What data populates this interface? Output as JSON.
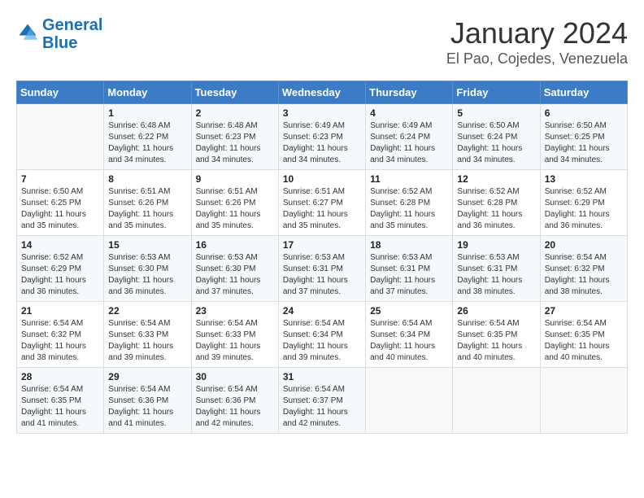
{
  "header": {
    "logo_line1": "General",
    "logo_line2": "Blue",
    "title": "January 2024",
    "subtitle": "El Pao, Cojedes, Venezuela"
  },
  "weekdays": [
    "Sunday",
    "Monday",
    "Tuesday",
    "Wednesday",
    "Thursday",
    "Friday",
    "Saturday"
  ],
  "weeks": [
    [
      {
        "day": "",
        "info": ""
      },
      {
        "day": "1",
        "info": "Sunrise: 6:48 AM\nSunset: 6:22 PM\nDaylight: 11 hours\nand 34 minutes."
      },
      {
        "day": "2",
        "info": "Sunrise: 6:48 AM\nSunset: 6:23 PM\nDaylight: 11 hours\nand 34 minutes."
      },
      {
        "day": "3",
        "info": "Sunrise: 6:49 AM\nSunset: 6:23 PM\nDaylight: 11 hours\nand 34 minutes."
      },
      {
        "day": "4",
        "info": "Sunrise: 6:49 AM\nSunset: 6:24 PM\nDaylight: 11 hours\nand 34 minutes."
      },
      {
        "day": "5",
        "info": "Sunrise: 6:50 AM\nSunset: 6:24 PM\nDaylight: 11 hours\nand 34 minutes."
      },
      {
        "day": "6",
        "info": "Sunrise: 6:50 AM\nSunset: 6:25 PM\nDaylight: 11 hours\nand 34 minutes."
      }
    ],
    [
      {
        "day": "7",
        "info": "Sunrise: 6:50 AM\nSunset: 6:25 PM\nDaylight: 11 hours\nand 35 minutes."
      },
      {
        "day": "8",
        "info": "Sunrise: 6:51 AM\nSunset: 6:26 PM\nDaylight: 11 hours\nand 35 minutes."
      },
      {
        "day": "9",
        "info": "Sunrise: 6:51 AM\nSunset: 6:26 PM\nDaylight: 11 hours\nand 35 minutes."
      },
      {
        "day": "10",
        "info": "Sunrise: 6:51 AM\nSunset: 6:27 PM\nDaylight: 11 hours\nand 35 minutes."
      },
      {
        "day": "11",
        "info": "Sunrise: 6:52 AM\nSunset: 6:28 PM\nDaylight: 11 hours\nand 35 minutes."
      },
      {
        "day": "12",
        "info": "Sunrise: 6:52 AM\nSunset: 6:28 PM\nDaylight: 11 hours\nand 36 minutes."
      },
      {
        "day": "13",
        "info": "Sunrise: 6:52 AM\nSunset: 6:29 PM\nDaylight: 11 hours\nand 36 minutes."
      }
    ],
    [
      {
        "day": "14",
        "info": "Sunrise: 6:52 AM\nSunset: 6:29 PM\nDaylight: 11 hours\nand 36 minutes."
      },
      {
        "day": "15",
        "info": "Sunrise: 6:53 AM\nSunset: 6:30 PM\nDaylight: 11 hours\nand 36 minutes."
      },
      {
        "day": "16",
        "info": "Sunrise: 6:53 AM\nSunset: 6:30 PM\nDaylight: 11 hours\nand 37 minutes."
      },
      {
        "day": "17",
        "info": "Sunrise: 6:53 AM\nSunset: 6:31 PM\nDaylight: 11 hours\nand 37 minutes."
      },
      {
        "day": "18",
        "info": "Sunrise: 6:53 AM\nSunset: 6:31 PM\nDaylight: 11 hours\nand 37 minutes."
      },
      {
        "day": "19",
        "info": "Sunrise: 6:53 AM\nSunset: 6:31 PM\nDaylight: 11 hours\nand 38 minutes."
      },
      {
        "day": "20",
        "info": "Sunrise: 6:54 AM\nSunset: 6:32 PM\nDaylight: 11 hours\nand 38 minutes."
      }
    ],
    [
      {
        "day": "21",
        "info": "Sunrise: 6:54 AM\nSunset: 6:32 PM\nDaylight: 11 hours\nand 38 minutes."
      },
      {
        "day": "22",
        "info": "Sunrise: 6:54 AM\nSunset: 6:33 PM\nDaylight: 11 hours\nand 39 minutes."
      },
      {
        "day": "23",
        "info": "Sunrise: 6:54 AM\nSunset: 6:33 PM\nDaylight: 11 hours\nand 39 minutes."
      },
      {
        "day": "24",
        "info": "Sunrise: 6:54 AM\nSunset: 6:34 PM\nDaylight: 11 hours\nand 39 minutes."
      },
      {
        "day": "25",
        "info": "Sunrise: 6:54 AM\nSunset: 6:34 PM\nDaylight: 11 hours\nand 40 minutes."
      },
      {
        "day": "26",
        "info": "Sunrise: 6:54 AM\nSunset: 6:35 PM\nDaylight: 11 hours\nand 40 minutes."
      },
      {
        "day": "27",
        "info": "Sunrise: 6:54 AM\nSunset: 6:35 PM\nDaylight: 11 hours\nand 40 minutes."
      }
    ],
    [
      {
        "day": "28",
        "info": "Sunrise: 6:54 AM\nSunset: 6:35 PM\nDaylight: 11 hours\nand 41 minutes."
      },
      {
        "day": "29",
        "info": "Sunrise: 6:54 AM\nSunset: 6:36 PM\nDaylight: 11 hours\nand 41 minutes."
      },
      {
        "day": "30",
        "info": "Sunrise: 6:54 AM\nSunset: 6:36 PM\nDaylight: 11 hours\nand 42 minutes."
      },
      {
        "day": "31",
        "info": "Sunrise: 6:54 AM\nSunset: 6:37 PM\nDaylight: 11 hours\nand 42 minutes."
      },
      {
        "day": "",
        "info": ""
      },
      {
        "day": "",
        "info": ""
      },
      {
        "day": "",
        "info": ""
      }
    ]
  ]
}
